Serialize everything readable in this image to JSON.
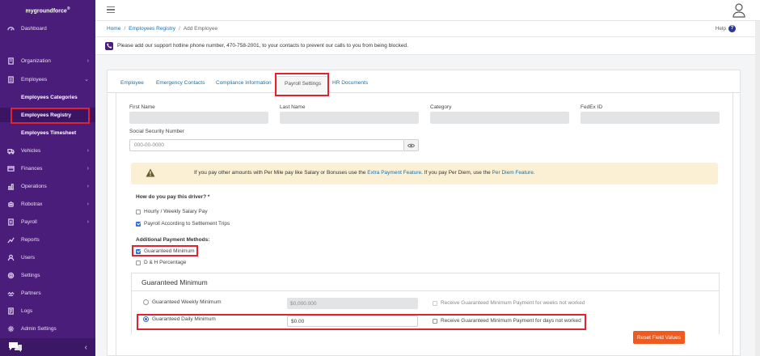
{
  "app": {
    "brand": "mygroundforce",
    "brand_mark": "®"
  },
  "sidebar": {
    "items": [
      {
        "label": "Dashboard",
        "icon": "dashboard-icon",
        "chevron": ""
      },
      {
        "label": "Organization",
        "icon": "building-icon",
        "chevron": "›"
      },
      {
        "label": "Employees",
        "icon": "employees-icon",
        "chevron": "⌄"
      },
      {
        "label": "Vehicles",
        "icon": "truck-icon",
        "chevron": "›"
      },
      {
        "label": "Finances",
        "icon": "finance-icon",
        "chevron": "›"
      },
      {
        "label": "Operations",
        "icon": "operations-icon",
        "chevron": "›"
      },
      {
        "label": "Robotrax",
        "icon": "robot-icon",
        "chevron": "›"
      },
      {
        "label": "Payroll",
        "icon": "payroll-icon",
        "chevron": "›"
      },
      {
        "label": "Reports",
        "icon": "reports-icon",
        "chevron": ""
      },
      {
        "label": "Users",
        "icon": "users-icon",
        "chevron": ""
      },
      {
        "label": "Settings",
        "icon": "gear-icon",
        "chevron": ""
      },
      {
        "label": "Partners",
        "icon": "partners-icon",
        "chevron": ""
      },
      {
        "label": "Logs",
        "icon": "logs-icon",
        "chevron": ""
      },
      {
        "label": "Admin Settings",
        "icon": "admin-gear-icon",
        "chevron": ""
      }
    ],
    "subitems": [
      {
        "label": "Employees Categories"
      },
      {
        "label": "Employees Registry",
        "active": true
      },
      {
        "label": "Employees Timesheet"
      }
    ],
    "collapse_glyph": "‹"
  },
  "breadcrumb": {
    "home": "Home",
    "registry": "Employees Registry",
    "current": "Add Employee",
    "sep": "/"
  },
  "help": {
    "label": "Help",
    "glyph": "?"
  },
  "notice": {
    "text": "Please add our support hotline phone number, 470-758-2001, to your contacts to prevent our calls to you from being blocked."
  },
  "tabs": [
    "Employee",
    "Emergency Contacts",
    "Compliance Information",
    "Payroll Settings",
    "HR Documents"
  ],
  "active_tab": "Payroll Settings",
  "fields": {
    "first_name": "First Name",
    "last_name": "Last Name",
    "category": "Category",
    "fedex_id": "FedEx ID",
    "ssn_label": "Social Security Number",
    "ssn_placeholder": "000-00-0000"
  },
  "warning": {
    "part1": "If you pay other amounts with Per Mile pay like Salary or Bonuses use the ",
    "link1": "Extra Payment Feature",
    "part2": ". If you pay Per Diem, use the ",
    "link2": "Per Diem Feature",
    "part3": "."
  },
  "pay": {
    "question": "How do you pay this driver? *",
    "options": [
      {
        "label": "Hourly / Weekly Salary Pay",
        "checked": false
      },
      {
        "label": "Payroll According to Settlement Trips",
        "checked": true
      }
    ],
    "additional_title": "Additional Payment Methods:",
    "additional": [
      {
        "label": "Guaranteed Minimum",
        "checked": true
      },
      {
        "label": "D & H Percentage",
        "checked": false
      }
    ]
  },
  "guaranteed": {
    "title": "Guaranteed Minimum",
    "weekly": {
      "label": "Guaranteed Weekly Minimum",
      "value": "$0,000.000",
      "selected": false,
      "receive": "Receive Guaranteed Minimum Payment for weeks not worked"
    },
    "daily": {
      "label": "Guaranteed Daily Minimum",
      "value": "$0.00",
      "selected": true,
      "receive": "Receive Guaranteed Minimum Payment for days not worked"
    },
    "reset": "Reset Field Values"
  },
  "colors": {
    "sidebar": "#4a1d7a",
    "accent": "#f15a1f",
    "link": "#1d6fa5",
    "highlight": "#e0232e",
    "warning_bg": "#fbf0d4"
  }
}
